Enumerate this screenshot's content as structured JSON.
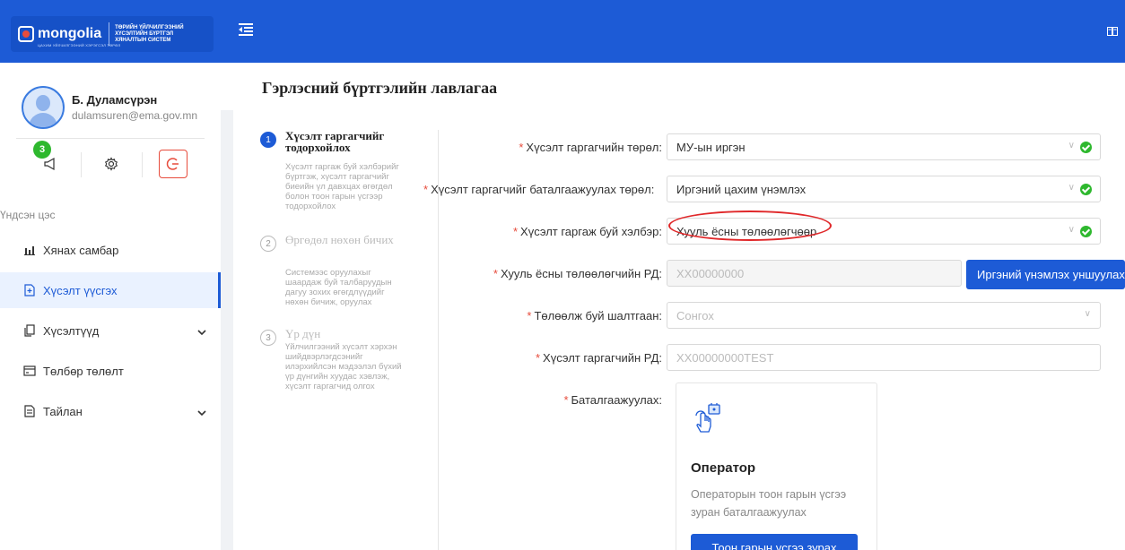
{
  "header": {
    "logo_text": "mongolia",
    "logo_tagline": "ЦАХИМ УЙЛЧИЛГЭЭНИЙ ХЭРЭГСЭЛ ТӨРӨЛ",
    "system_name": "ТӨРИЙН ҮЙЛЧИЛГЭЭНИЙ ХҮСЭЛТИЙН БҮРТГЭЛ ХЯНАЛТЫН СИСТЕМ"
  },
  "user": {
    "name": "Б. Дуламсүрэн",
    "email": "dulamsuren@ema.gov.mn",
    "notification_count": "3"
  },
  "sidebar": {
    "section_label": "Үндсэн цэс",
    "items": [
      {
        "label": "Хянах самбар",
        "icon": "chart-icon"
      },
      {
        "label": "Хүсэлт үүсгэх",
        "icon": "add-document-icon",
        "active": true
      },
      {
        "label": "Хүсэлтүүд",
        "icon": "copy-icon",
        "has_children": true
      },
      {
        "label": "Төлбөр төлөлт",
        "icon": "wallet-icon"
      },
      {
        "label": "Тайлан",
        "icon": "report-icon",
        "has_children": true
      }
    ]
  },
  "page": {
    "title": "Гэрлэсний бүртгэлийн лавлагаа"
  },
  "steps": [
    {
      "number": "1",
      "title": "Хүсэлт гаргагчийг тодорхойлох",
      "description": "Хүсэлт гаргаж буй хэлбэрийг бүртгэж, хүсэлт гаргагчийг биеийн үл давхцах өгөгдөл болон тоон гарын үсгээр тодорхойлох",
      "active": true
    },
    {
      "number": "2",
      "title": "Өргөдөл нөхөн бичих",
      "description": "Системээс оруулахыг шаардаж буй талбаруудын дагуу зохих өгөгдлүүдийг нөхөн бичиж, оруулах",
      "active": false
    },
    {
      "number": "3",
      "title": "Үр дүн",
      "description": "Үйлчилгээний хүсэлт хэрхэн шийдвэрлэгдсэнийг илэрхийлсэн мэдээлэл бүхий үр дүнгийн хуудас хэвлэж, хүсэлт гаргагчид олгох",
      "active": false
    }
  ],
  "form": {
    "requester_type": {
      "label": "Хүсэлт гаргагчийн төрөл:",
      "value": "МУ-ын иргэн"
    },
    "verification_type": {
      "label": "Хүсэлт гаргагчийг баталгаажуулах төрөл:",
      "value": "Иргэний цахим үнэмлэх"
    },
    "request_form": {
      "label": "Хүсэлт гаргаж буй хэлбэр:",
      "value": "Хууль ёсны төлөөлөгчөөр"
    },
    "rep_register": {
      "label": "Хууль ёсны төлөөлөгчийн РД:",
      "placeholder": "XX00000000",
      "button": "Иргэний үнэмлэх уншуулах"
    },
    "rep_reason": {
      "label": "Төлөөлж буй шалтгаан:",
      "placeholder": "Сонгох"
    },
    "requester_register": {
      "label": "Хүсэлт гаргагчийн РД:",
      "placeholder": "XX00000000TEST"
    },
    "confirmation": {
      "label": "Баталгаажуулах:"
    }
  },
  "operator_card": {
    "title": "Оператор",
    "description": "Операторын тоон гарын үсгээ зуран баталгаажуулах",
    "button": "Тоон гарын үсгээ зурах"
  },
  "colors": {
    "primary": "#1d5bd6",
    "success": "#2eb82e",
    "danger": "#e0282a"
  }
}
